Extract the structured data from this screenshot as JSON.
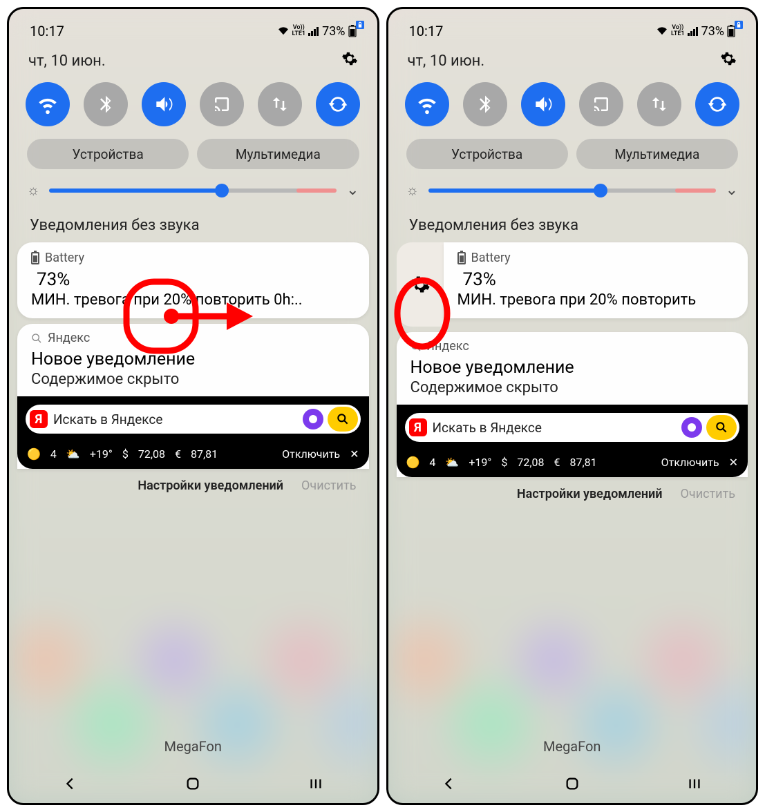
{
  "status": {
    "time": "10:17",
    "battery_pct": "73%",
    "vo": "Vo))",
    "lte": "LTE1"
  },
  "date": "чт, 10 июн.",
  "quick_settings": [
    {
      "name": "wifi",
      "on": true
    },
    {
      "name": "bluetooth",
      "on": false
    },
    {
      "name": "sound",
      "on": true
    },
    {
      "name": "cast",
      "on": false
    },
    {
      "name": "data-swap",
      "on": false
    },
    {
      "name": "rotate",
      "on": true
    }
  ],
  "panels": {
    "devices": "Устройства",
    "media": "Мультимедиа"
  },
  "brightness_pct": 60,
  "section_silent": "Уведомления без звука",
  "notif_battery": {
    "app": "Battery",
    "pct": "73%",
    "sub_left": "МИН. тревога при 20% повторить 0h:..",
    "sub_right": "МИН. тревога при 20% повторить"
  },
  "notif_yandex": {
    "app": "Яндекс",
    "title": "Новое уведомление",
    "sub": "Содержимое скрыто"
  },
  "yandex_widget": {
    "search_placeholder": "Искать в Яндексе",
    "badge": "Я",
    "strip": {
      "air": "4",
      "weather": "+19°",
      "usd": "72,08",
      "eur": "87,81",
      "off": "Отключить"
    }
  },
  "bottom": {
    "settings": "Настройки уведомлений",
    "clear": "Очистить"
  },
  "carrier": "MegaFon"
}
